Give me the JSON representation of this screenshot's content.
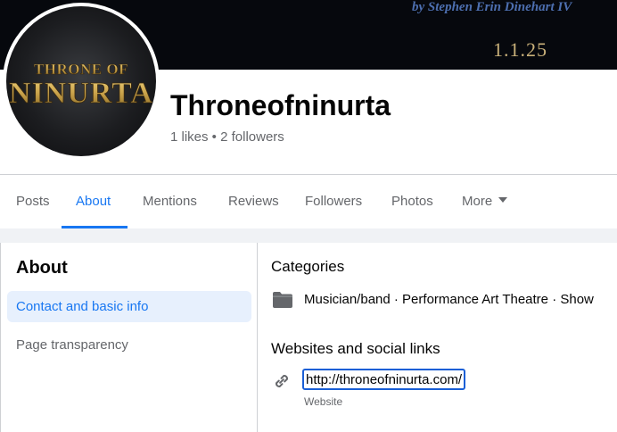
{
  "cover": {
    "credit_text": "by Stephen Erin Dinehart IV",
    "date_text": "1.1.25"
  },
  "profile": {
    "logo_line1": "THRONE OF",
    "logo_line2": "NINURTA",
    "name": "Throneofninurta",
    "stats": "1 likes • 2 followers"
  },
  "tabs": [
    {
      "label": "Posts"
    },
    {
      "label": "About"
    },
    {
      "label": "Mentions"
    },
    {
      "label": "Reviews"
    },
    {
      "label": "Followers"
    },
    {
      "label": "Photos"
    },
    {
      "label": "More"
    }
  ],
  "sidebar": {
    "heading": "About",
    "items": [
      {
        "label": "Contact and basic info"
      },
      {
        "label": "Page transparency"
      }
    ]
  },
  "main": {
    "categories_heading": "Categories",
    "categories_value": "Musician/band · Performance Art Theatre · Show",
    "links_heading": "Websites and social links",
    "website_url": "http://throneofninurta.com/",
    "website_caption": "Website"
  },
  "colors": {
    "accent": "#1877f2",
    "secondary_text": "#65676b",
    "active_nav_bg": "#e7f0fd",
    "logo_gold": "#c9a24a"
  },
  "icons": {
    "category": "folder-icon",
    "website": "link-icon",
    "more": "caret-down-icon"
  }
}
